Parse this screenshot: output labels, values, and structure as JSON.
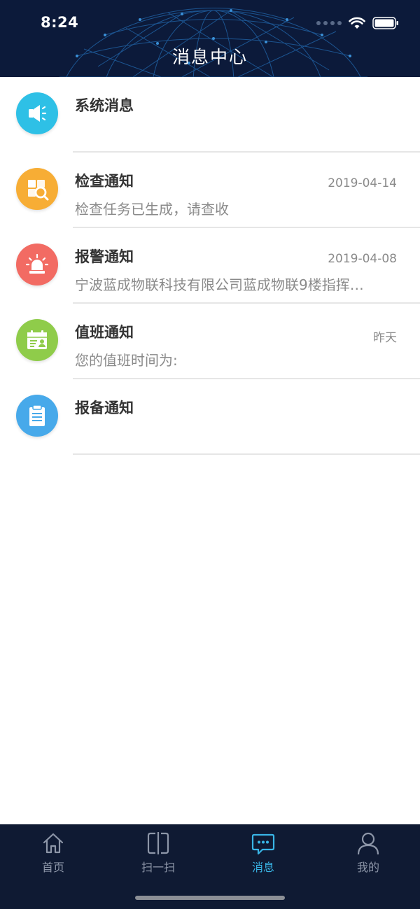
{
  "status_bar": {
    "time": "8:24"
  },
  "header": {
    "title": "消息中心"
  },
  "messages": [
    {
      "title": "系统消息",
      "date": "",
      "preview": "",
      "icon": "megaphone-icon",
      "color": "#2ec0e6"
    },
    {
      "title": "检查通知",
      "date": "2019-04-14",
      "preview": "检查任务已生成，请查收",
      "icon": "inspection-icon",
      "color": "#f7ad35"
    },
    {
      "title": "报警通知",
      "date": "2019-04-08",
      "preview": "宁波蓝成物联科技有限公司蓝成物联9楼指挥…",
      "icon": "alarm-light-icon",
      "color": "#f26b63"
    },
    {
      "title": "值班通知",
      "date": "昨天",
      "preview": "您的值班时间为:",
      "icon": "duty-calendar-icon",
      "color": "#8fcc4a"
    },
    {
      "title": "报备通知",
      "date": "",
      "preview": "",
      "icon": "clipboard-icon",
      "color": "#47a9ea"
    }
  ],
  "tabbar": {
    "items": [
      {
        "label": "首页",
        "icon": "home-icon",
        "active": false
      },
      {
        "label": "扫一扫",
        "icon": "scan-icon",
        "active": false
      },
      {
        "label": "消息",
        "icon": "chat-icon",
        "active": true
      },
      {
        "label": "我的",
        "icon": "person-icon",
        "active": false
      }
    ],
    "active_color": "#39b5e6",
    "inactive_color": "#8d96a8"
  }
}
